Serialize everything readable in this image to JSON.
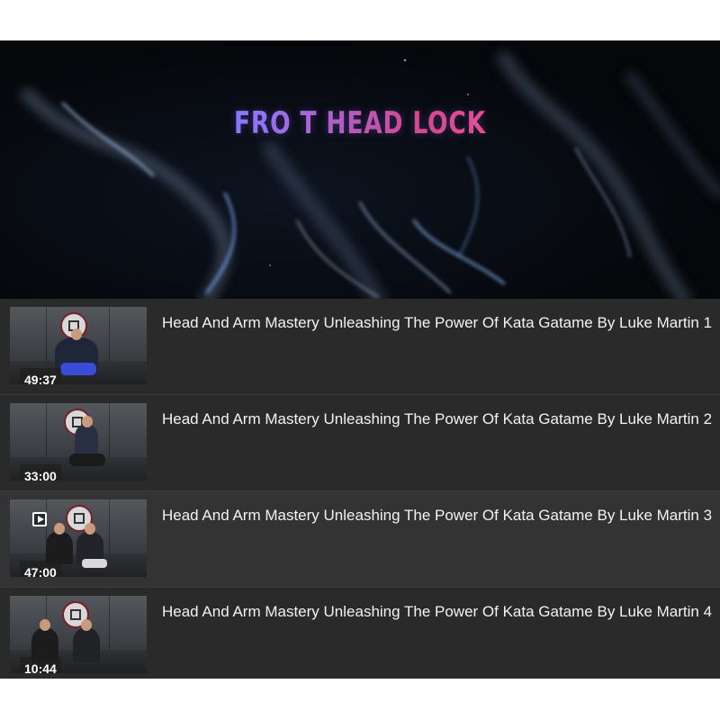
{
  "player": {
    "title_art": "FRO  T HEAD LOCK",
    "accent": "#e0457a"
  },
  "playlist": {
    "items": [
      {
        "title": "Head And Arm Mastery Unleashing The Power Of Kata Gatame By Luke Martin 1",
        "duration": "49:37",
        "active": false
      },
      {
        "title": "Head And Arm Mastery Unleashing The Power Of Kata Gatame By Luke Martin 2",
        "duration": "33:00",
        "active": false
      },
      {
        "title": "Head And Arm Mastery Unleashing The Power Of Kata Gatame By Luke Martin 3",
        "duration": "47:00",
        "active": true,
        "icon": "play-icon"
      },
      {
        "title": "Head And Arm Mastery Unleashing The Power Of Kata Gatame By Luke Martin 4",
        "duration": "10:44",
        "active": false
      }
    ]
  },
  "colors": {
    "playlist_bg": "#2a2a2a",
    "active_row_bg": "#333333",
    "text": "#f2f2f2"
  }
}
